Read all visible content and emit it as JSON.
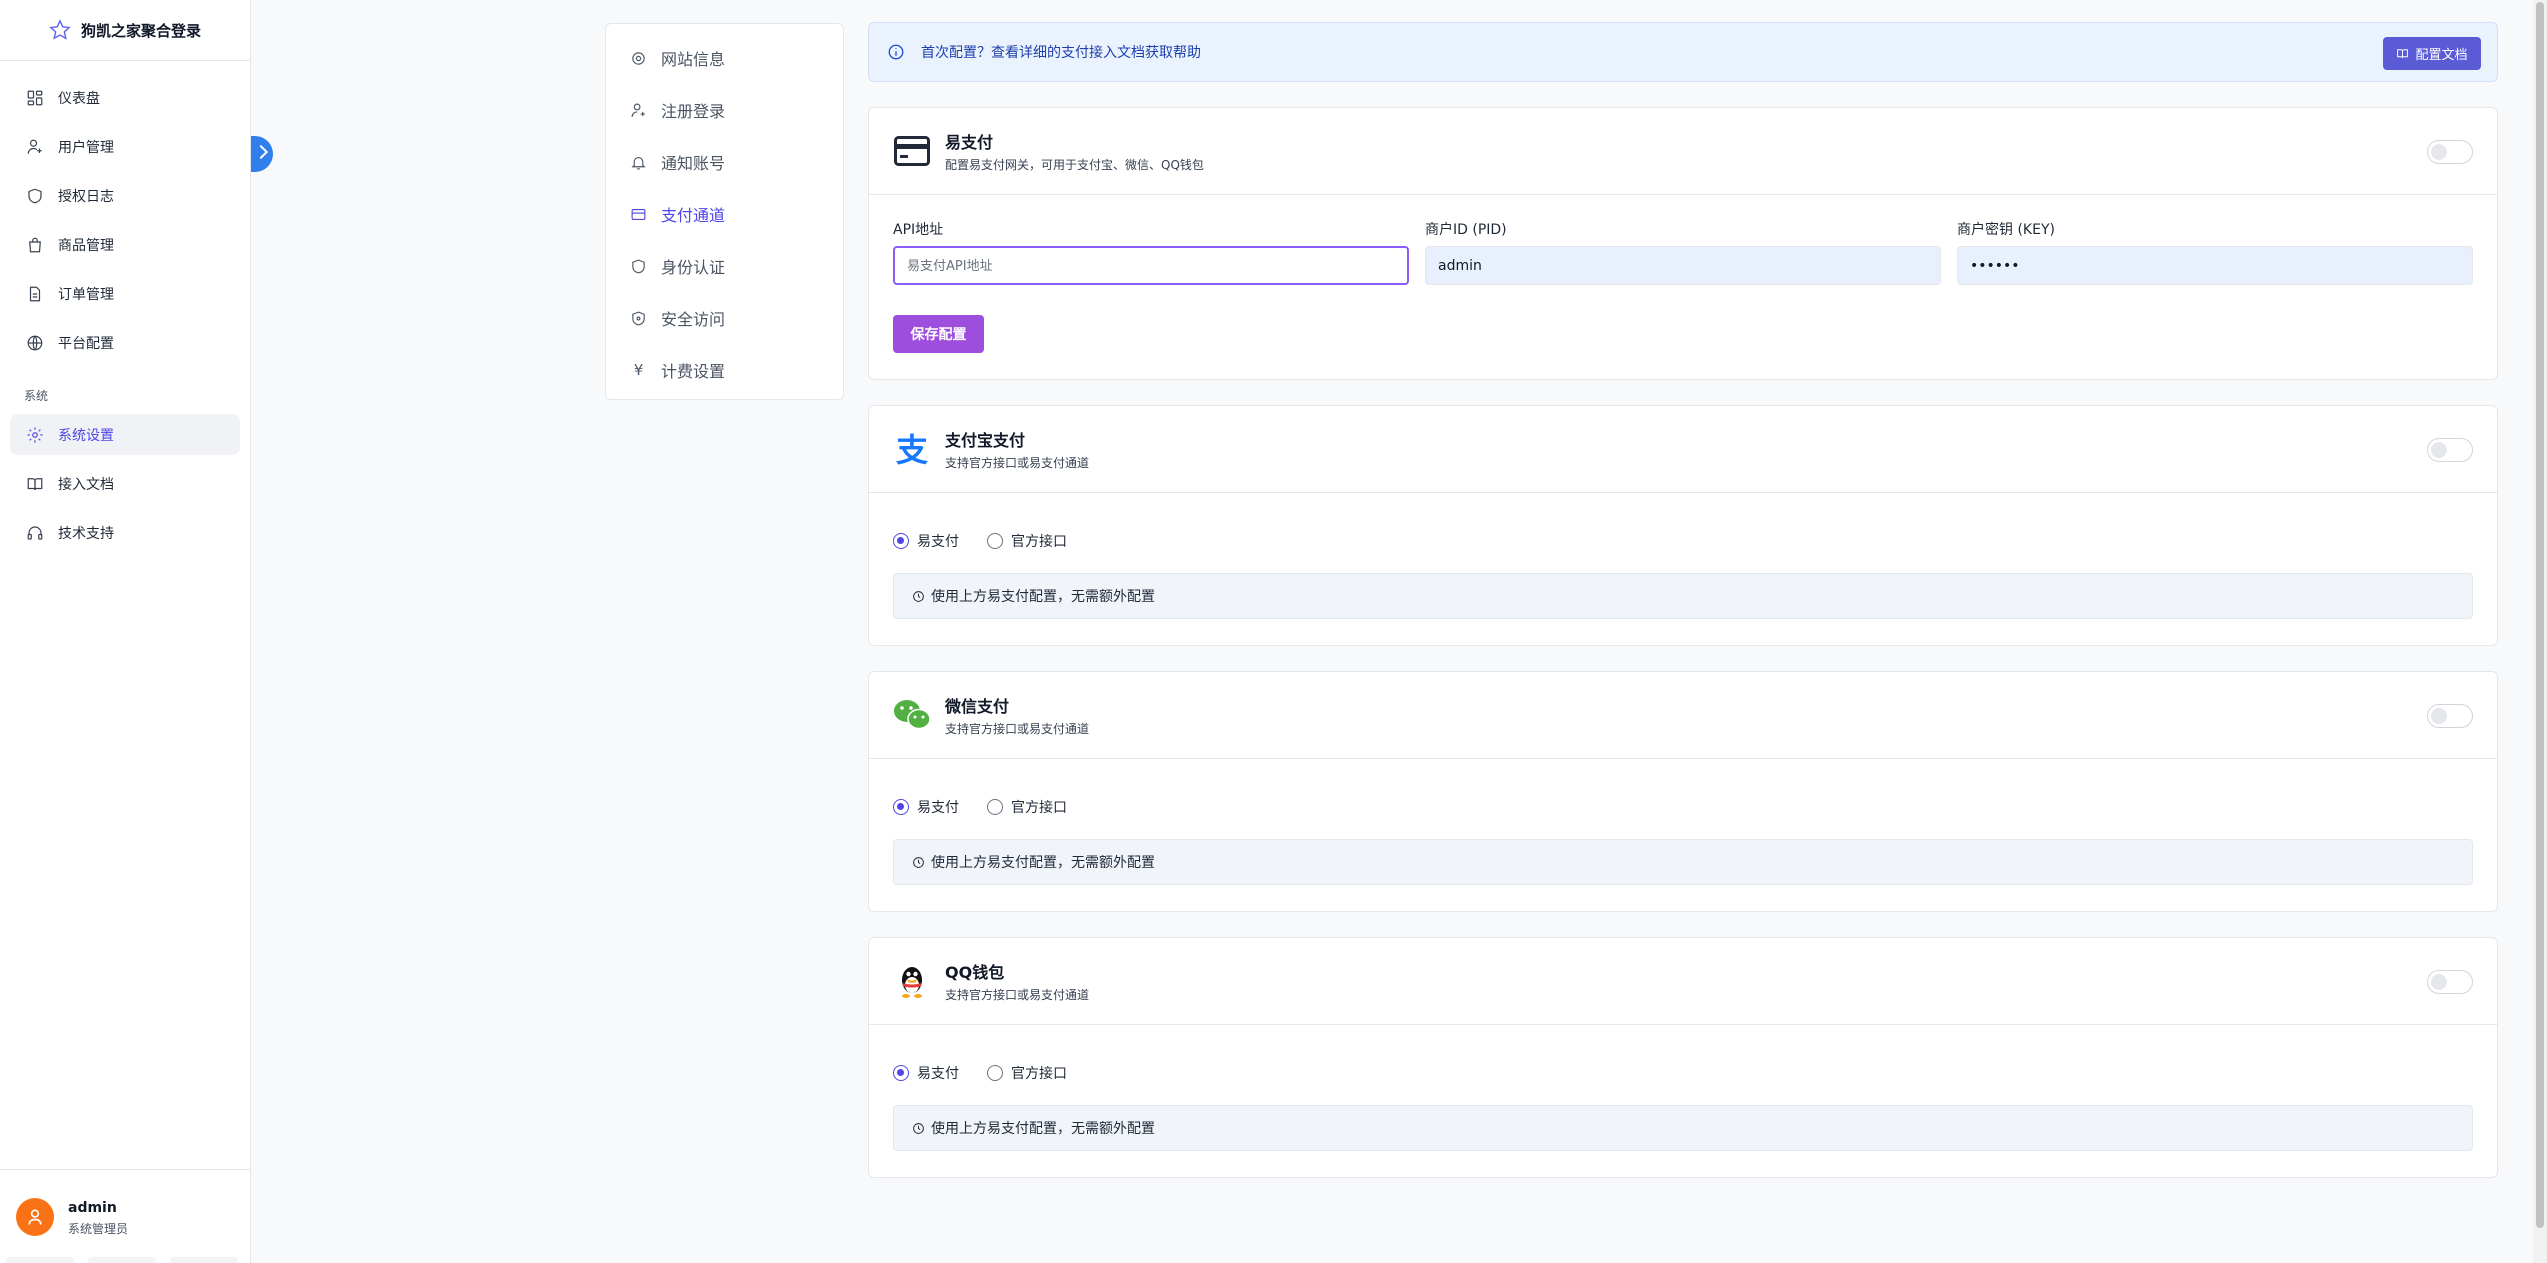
{
  "brand": {
    "name": "狗凯之家聚合登录",
    "logo_icon": "star-logo-icon"
  },
  "sidebar": {
    "items": [
      {
        "label": "仪表盘",
        "icon": "dashboard-icon"
      },
      {
        "label": "用户管理",
        "icon": "user-icon"
      },
      {
        "label": "授权日志",
        "icon": "shield-icon"
      },
      {
        "label": "商品管理",
        "icon": "bag-icon"
      },
      {
        "label": "订单管理",
        "icon": "document-icon"
      },
      {
        "label": "平台配置",
        "icon": "globe-icon"
      }
    ],
    "section_label": "系统",
    "system_items": [
      {
        "label": "系统设置",
        "icon": "gear-icon",
        "active": true
      },
      {
        "label": "接入文档",
        "icon": "book-icon"
      },
      {
        "label": "技术支持",
        "icon": "headset-icon"
      }
    ]
  },
  "user": {
    "name": "admin",
    "role": "系统管理员",
    "avatar_color": "#f97316"
  },
  "submenu": {
    "items": [
      {
        "label": "网站信息",
        "icon": "gear-icon"
      },
      {
        "label": "注册登录",
        "icon": "user-plus-icon"
      },
      {
        "label": "通知账号",
        "icon": "bell-icon"
      },
      {
        "label": "支付通道",
        "icon": "credit-card-icon",
        "active": true
      },
      {
        "label": "身份认证",
        "icon": "shield-icon"
      },
      {
        "label": "安全访问",
        "icon": "shield-check-icon"
      },
      {
        "label": "计费设置",
        "icon": "yen-icon",
        "glyph": "¥"
      }
    ]
  },
  "banner": {
    "text": "首次配置？查看详细的支付接入文档获取帮助",
    "button_label": "配置文档"
  },
  "epay": {
    "title": "易支付",
    "desc": "配置易支付网关，可用于支付宝、微信、QQ钱包",
    "api_label": "API地址",
    "api_placeholder": "易支付API地址",
    "api_value": "",
    "pid_label": "商户ID (PID)",
    "pid_value": "admin",
    "key_label": "商户密钥 (KEY)",
    "key_value": "••••••",
    "save_label": "保存配置"
  },
  "channels": [
    {
      "title": "支付宝支付",
      "desc": "支持官方接口或易支付通道",
      "opt1": "易支付",
      "opt2": "官方接口",
      "note": "使用上方易支付配置，无需额外配置",
      "icon": "alipay-icon"
    },
    {
      "title": "微信支付",
      "desc": "支持官方接口或易支付通道",
      "opt1": "易支付",
      "opt2": "官方接口",
      "note": "使用上方易支付配置，无需额外配置",
      "icon": "wechat-icon"
    },
    {
      "title": "QQ钱包",
      "desc": "支持官方接口或易支付通道",
      "opt1": "易支付",
      "opt2": "官方接口",
      "note": "使用上方易支付配置，无需额外配置",
      "icon": "qq-icon"
    }
  ],
  "colors": {
    "accent": "#4f46e5",
    "save_button": "#9d4edd",
    "doc_button": "#5b5bd6",
    "alipay": "#1677ff",
    "wechat": "#52b043"
  }
}
